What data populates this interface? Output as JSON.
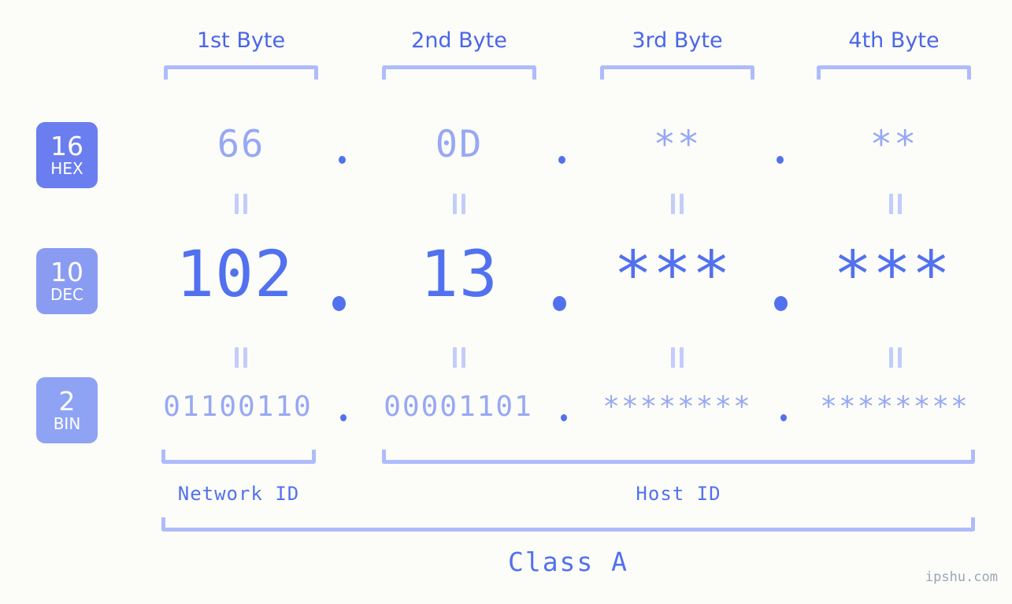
{
  "background_color": "#fcfdf8",
  "accent_color": "#5271ef",
  "accent_light_color": "#97a8f4",
  "bracket_color": "#aebcfb",
  "byte_headers": [
    {
      "label": "1st Byte"
    },
    {
      "label": "2nd Byte"
    },
    {
      "label": "3rd Byte"
    },
    {
      "label": "4th Byte"
    }
  ],
  "bases": [
    {
      "number": "16",
      "name": "HEX",
      "color": "#6a7ef0"
    },
    {
      "number": "10",
      "name": "DEC",
      "color": "#8a9cf2"
    },
    {
      "number": "2",
      "name": "BIN",
      "color": "#8fa3f5"
    }
  ],
  "rows": {
    "hex": {
      "values": [
        "66",
        "0D",
        "**",
        "**"
      ],
      "separator": "."
    },
    "dec": {
      "values": [
        "102",
        "13",
        "***",
        "***"
      ],
      "separator": "."
    },
    "bin": {
      "values": [
        "01100110",
        "00001101",
        "********",
        "********"
      ],
      "separator": "."
    }
  },
  "equals_marks": {
    "glyph": "||",
    "count_per_row": 4
  },
  "segments": {
    "network_id": "Network ID",
    "host_id": "Host ID"
  },
  "class_label": "Class A",
  "watermark": "ipshu.com"
}
